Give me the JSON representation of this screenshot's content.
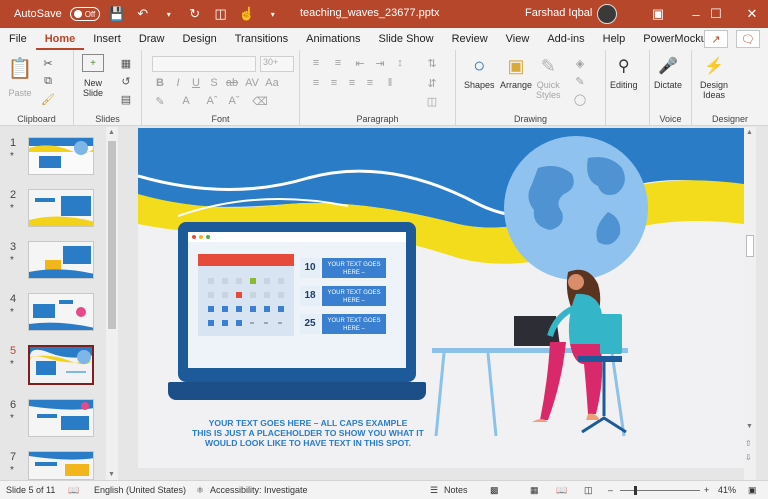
{
  "titlebar": {
    "autosave_label": "AutoSave",
    "autosave_state": "Off",
    "document_title": "teaching_waves_23677.pptx",
    "user_name": "Farshad Iqbal",
    "accent_color": "#b7472a"
  },
  "menu": {
    "tabs": [
      "File",
      "Home",
      "Insert",
      "Draw",
      "Design",
      "Transitions",
      "Animations",
      "Slide Show",
      "Review",
      "View",
      "Add-ins",
      "Help",
      "PowerMockup"
    ],
    "active": "Home"
  },
  "ribbon": {
    "clipboard": {
      "label": "Clipboard",
      "paste": "Paste"
    },
    "slides": {
      "label": "Slides",
      "new_slide_line1": "New",
      "new_slide_line2": "Slide"
    },
    "font": {
      "label": "Font",
      "font_size": "30+"
    },
    "paragraph": {
      "label": "Paragraph"
    },
    "drawing": {
      "label": "Drawing",
      "shapes": "Shapes",
      "arrange": "Arrange",
      "quick_styles_line1": "Quick",
      "quick_styles_line2": "Styles"
    },
    "editing": {
      "label": "Editing"
    },
    "voice": {
      "label": "Voice",
      "dictate": "Dictate"
    },
    "designer": {
      "label": "Designer",
      "design_ideas_line1": "Design",
      "design_ideas_line2": "Ideas"
    }
  },
  "thumbnails": [
    {
      "num": "1",
      "star": "*"
    },
    {
      "num": "2",
      "star": "*"
    },
    {
      "num": "3",
      "star": "*"
    },
    {
      "num": "4",
      "star": "*"
    },
    {
      "num": "5",
      "star": "*"
    },
    {
      "num": "6",
      "star": "*"
    },
    {
      "num": "7",
      "star": "*"
    }
  ],
  "selected_slide": 5,
  "slide": {
    "calendar_rows": [
      {
        "date": "10",
        "text_line1": "YOUR TEXT GOES",
        "text_line2": "HERE –"
      },
      {
        "date": "18",
        "text_line1": "YOUR TEXT GOES",
        "text_line2": "HERE –"
      },
      {
        "date": "25",
        "text_line1": "YOUR TEXT GOES",
        "text_line2": "HERE –"
      }
    ],
    "caption_line1": "YOUR TEXT GOES HERE – ALL CAPS EXAMPLE",
    "caption_line2": "THIS IS JUST A PLACEHOLDER TO SHOW YOU WHAT IT",
    "caption_line3": "WOULD LOOK LIKE TO HAVE TEXT IN THIS SPOT."
  },
  "status": {
    "slide_of": "Slide 5 of 11",
    "language": "English (United States)",
    "accessibility": "Accessibility: Investigate",
    "notes": "Notes",
    "zoom": "41%"
  }
}
